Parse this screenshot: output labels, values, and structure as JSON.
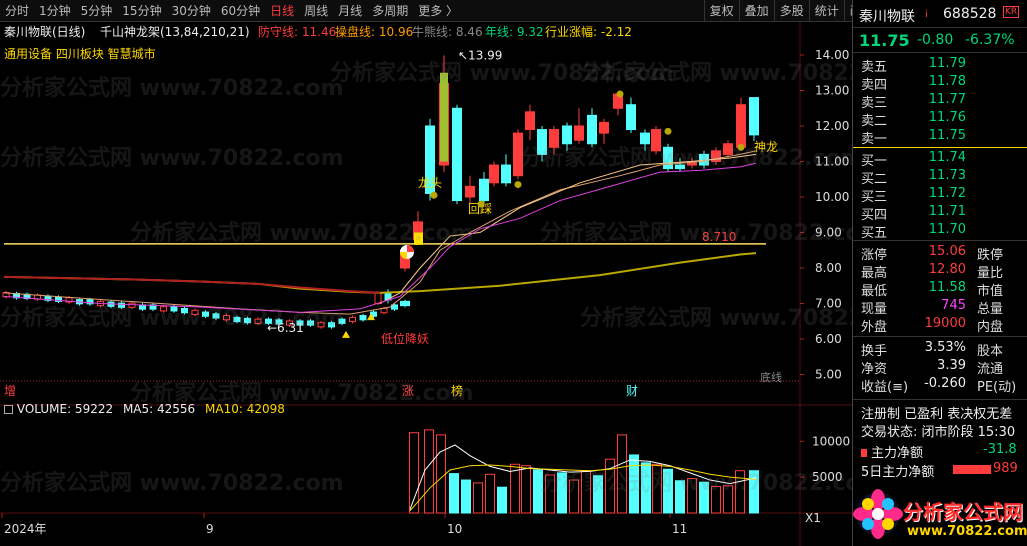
{
  "toolbar": {
    "left_tabs": [
      "分时",
      "1分钟",
      "5分钟",
      "15分钟",
      "30分钟",
      "60分钟",
      "日线",
      "周线",
      "月线",
      "多周期",
      "更多 〉"
    ],
    "active": "日线",
    "right_tabs": [
      "复权",
      "叠加",
      "多股",
      "统计",
      "画线",
      "F10",
      "标记",
      "+自选",
      "返回"
    ]
  },
  "header": {
    "stock": "秦川物联(日线)",
    "indicator": "千山神龙架(13,84,210,21)",
    "defense": "防守线: 11.46",
    "control": "操盘线: 10.96",
    "bull": "牛熊线: 8.46",
    "year": "年线: 9.32",
    "industry": "行业涨幅: -2.12",
    "tags": "通用设备  四川板块  智慧城市"
  },
  "watermark": "分析家公式网 www.70822.com",
  "chart_labels": {
    "high": "13.99",
    "low": "6.31",
    "level": "8.710",
    "dragon_head": "龙头",
    "pullback": "回踩",
    "god_dragon": "神龙",
    "low_level": "低位降妖",
    "bottom_line": "底线",
    "events": [
      "增",
      "涨",
      "榜",
      "财"
    ]
  },
  "price_axis": [
    "14.00",
    "13.00",
    "12.00",
    "11.00",
    "10.00",
    "9.00",
    "8.00",
    "7.00",
    "6.00",
    "5.00"
  ],
  "volume_header": {
    "title": "VOLUME: 59222",
    "ma5": "MA5: 42556",
    "ma10": "MA10: 42098"
  },
  "volume_axis": [
    "10000",
    "5000"
  ],
  "volume_unit": "X1",
  "date_axis": [
    "2024年",
    "9",
    "10",
    "11"
  ],
  "colors": {
    "up": "#ff3c3c",
    "down": "#54ffff",
    "bg": "#000000"
  },
  "quote": {
    "name": "秦川物联",
    "code": "688528",
    "badge": "KR",
    "price": "11.75",
    "change": "-0.80",
    "pct": "-6.37%",
    "asks": [
      {
        "label": "卖五",
        "price": "11.79"
      },
      {
        "label": "卖四",
        "price": "11.78"
      },
      {
        "label": "卖三",
        "price": "11.77"
      },
      {
        "label": "卖二",
        "price": "11.76"
      },
      {
        "label": "卖一",
        "price": "11.75"
      }
    ],
    "bids": [
      {
        "label": "买一",
        "price": "11.74"
      },
      {
        "label": "买二",
        "price": "11.73"
      },
      {
        "label": "买三",
        "price": "11.72"
      },
      {
        "label": "买四",
        "price": "11.71"
      },
      {
        "label": "买五",
        "price": "11.70"
      }
    ],
    "stats": [
      {
        "l": "涨停",
        "v": "15.06",
        "r": "跌停"
      },
      {
        "l": "最高",
        "v": "12.80",
        "r": "量比"
      },
      {
        "l": "最低",
        "v": "11.58",
        "r": "市值"
      },
      {
        "l": "现量",
        "v": "745",
        "r": "总量"
      },
      {
        "l": "外盘",
        "v": "19000",
        "r": "内盘"
      }
    ],
    "stats2": [
      {
        "l": "换手",
        "v": "3.53%",
        "r": "股本"
      },
      {
        "l": "净资",
        "v": "3.39",
        "r": "流通"
      },
      {
        "l": "收益(≡)",
        "v": "-0.260",
        "r": "PE(动)"
      }
    ],
    "info1": "注册制 已盈利 表决权无差",
    "info2": "交易状态: 闭市阶段 15:30",
    "main_net_label": "主力净额",
    "main_net_value": "-31.8",
    "five_day_label": "5日主力净额",
    "five_day_value": "989",
    "logo_text": "分析家公式网",
    "logo_url": "www.70822.com"
  }
}
